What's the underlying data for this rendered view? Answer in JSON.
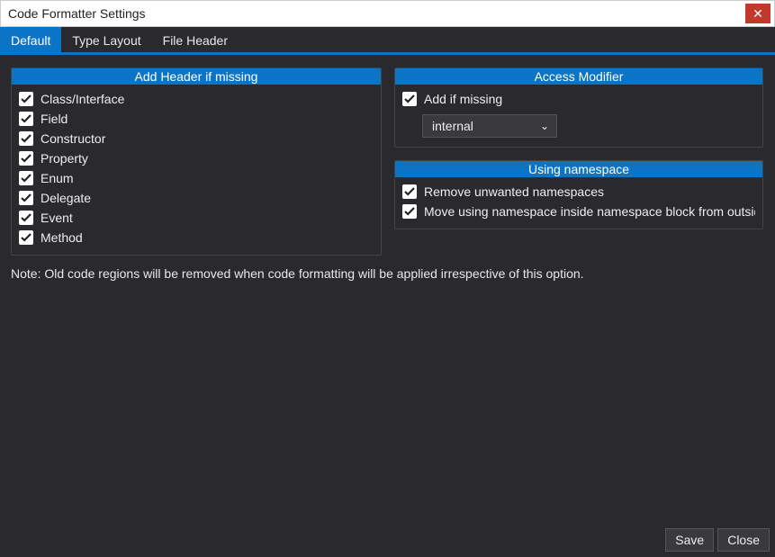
{
  "window": {
    "title": "Code Formatter Settings"
  },
  "tabs": {
    "default": "Default",
    "type_layout": "Type Layout",
    "file_header": "File Header"
  },
  "panels": {
    "header": {
      "title": "Add Header if missing",
      "items": {
        "class_interface": "Class/Interface",
        "field": "Field",
        "constructor": "Constructor",
        "property": "Property",
        "enum": "Enum",
        "delegate": "Delegate",
        "event": "Event",
        "method": "Method"
      }
    },
    "access": {
      "title": "Access Modifier",
      "add_if_missing": "Add if missing",
      "select_value": "internal"
    },
    "usingns": {
      "title": "Using namespace",
      "remove_unwanted": "Remove unwanted namespaces",
      "move_inside": "Move using namespace inside namespace block from outside"
    }
  },
  "note": "Note: Old code regions will be removed when code formatting will be applied irrespective of this option.",
  "footer": {
    "save": "Save",
    "close": "Close"
  }
}
